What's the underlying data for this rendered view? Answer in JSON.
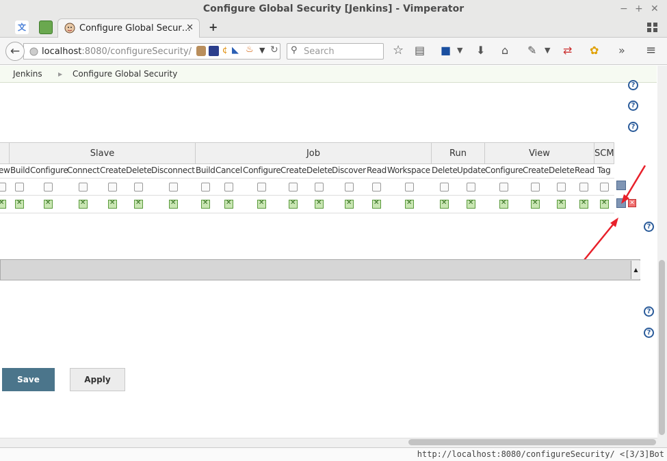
{
  "window": {
    "title": "Configure Global Security [Jenkins] - Vimperator"
  },
  "tab": {
    "title": "Configure Global Secur…",
    "close": "✕",
    "new_tab": "+"
  },
  "nav": {
    "url_host": "localhost",
    "url_rest": ":8080/configureSecurity/",
    "search_placeholder": "Search"
  },
  "breadcrumb": {
    "root": "Jenkins",
    "page": "Configure Global Security"
  },
  "matrix": {
    "groups": [
      "Slave",
      "Job",
      "Run",
      "View",
      "SCM"
    ],
    "permissions": [
      "ew",
      "Build",
      "Configure",
      "Connect",
      "Create",
      "Delete",
      "Disconnect",
      "Build",
      "Cancel",
      "Configure",
      "Create",
      "Delete",
      "Discover",
      "Read",
      "Workspace",
      "Delete",
      "Update",
      "Configure",
      "Create",
      "Delete",
      "Read",
      "Tag"
    ],
    "rows": [
      {
        "checked": false
      },
      {
        "checked": true
      }
    ]
  },
  "buttons": {
    "save": "Save",
    "apply": "Apply"
  },
  "status": {
    "text": "http://localhost:8080/configureSecurity/ <[3/3]Bot"
  },
  "colors": {
    "save_bg": "#4b758b",
    "help": "#2a5b9a",
    "arrow": "#e8202a"
  }
}
